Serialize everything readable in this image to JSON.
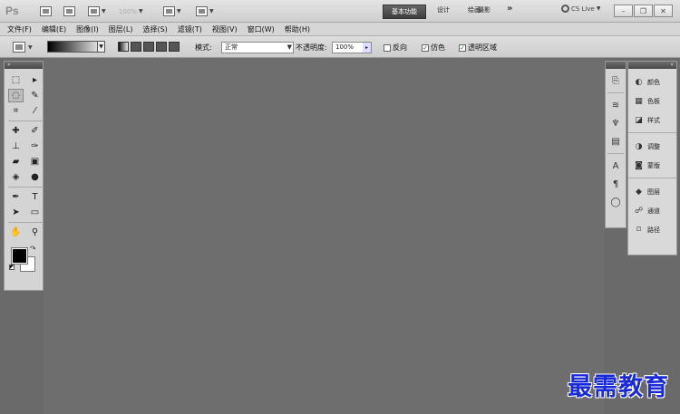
{
  "appbar": {
    "logo": "Ps",
    "zoom": "100%",
    "workspaces": {
      "active": "基本功能",
      "items": [
        "设计",
        "绘画",
        "摄影"
      ],
      "more": "»"
    },
    "cslive": "CS Live"
  },
  "menu": [
    "文件(F)",
    "编辑(E)",
    "图像(I)",
    "图层(L)",
    "选择(S)",
    "滤镜(T)",
    "视图(V)",
    "窗口(W)",
    "帮助(H)"
  ],
  "options": {
    "mode_label": "模式:",
    "mode_value": "正常",
    "opacity_label": "不透明度:",
    "opacity_value": "100%",
    "reverse_label": "反向",
    "dither_label": "仿色",
    "transparency_label": "透明区域",
    "reverse_checked": false,
    "dither_checked": true,
    "transparency_checked": true
  },
  "panels": [
    {
      "icon": "color-icon",
      "label": "颜色"
    },
    {
      "icon": "swatches-icon",
      "label": "色板"
    },
    {
      "icon": "styles-icon",
      "label": "样式"
    },
    {
      "icon": "adjustments-icon",
      "label": "调整"
    },
    {
      "icon": "masks-icon",
      "label": "蒙版"
    },
    {
      "icon": "layers-icon",
      "label": "图层"
    },
    {
      "icon": "channels-icon",
      "label": "通道"
    },
    {
      "icon": "paths-icon",
      "label": "路径"
    }
  ],
  "watermark": "最需教育"
}
